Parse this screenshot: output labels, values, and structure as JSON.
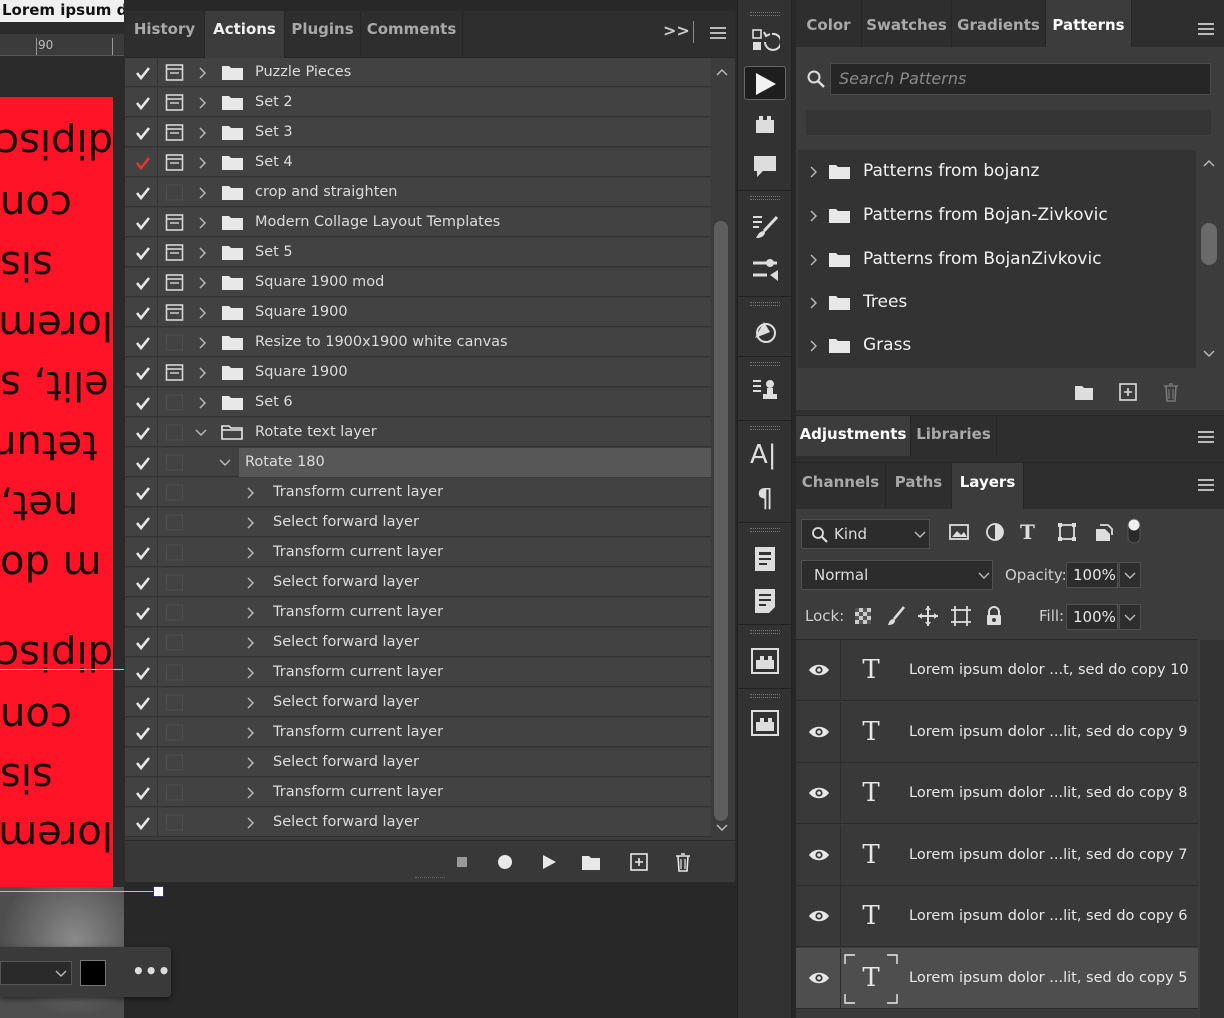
{
  "document": {
    "title": "Lorem ipsum do",
    "ruler_value": "90",
    "canvas_text_lines": [
      "dipisc",
      "con",
      "sis",
      "lorem",
      "elit, s",
      "tetur",
      "net,",
      "m do",
      "dipisc",
      "con",
      "sis",
      "lorem"
    ]
  },
  "actions_panel": {
    "tabs": [
      {
        "label": "History",
        "active": false
      },
      {
        "label": "Actions",
        "active": true
      },
      {
        "label": "Plugins",
        "active": false
      },
      {
        "label": "Comments",
        "active": false
      }
    ],
    "collapse_glyph": ">>",
    "rows": [
      {
        "label": "Puzzle Pieces",
        "level": 0,
        "check_color": "white",
        "dialog": true,
        "expanded": false
      },
      {
        "label": "Set 2",
        "level": 0,
        "check_color": "white",
        "dialog": true,
        "expanded": false
      },
      {
        "label": "Set 3",
        "level": 0,
        "check_color": "white",
        "dialog": true,
        "expanded": false
      },
      {
        "label": "Set 4",
        "level": 0,
        "check_color": "red",
        "dialog": true,
        "expanded": false
      },
      {
        "label": "crop and straighten",
        "level": 0,
        "check_color": "white",
        "dialog": false,
        "expanded": false
      },
      {
        "label": "Modern Collage Layout Templates",
        "level": 0,
        "check_color": "white",
        "dialog": true,
        "expanded": false
      },
      {
        "label": "Set 5",
        "level": 0,
        "check_color": "white",
        "dialog": true,
        "expanded": false
      },
      {
        "label": "Square 1900 mod",
        "level": 0,
        "check_color": "white",
        "dialog": true,
        "expanded": false
      },
      {
        "label": "Square 1900",
        "level": 0,
        "check_color": "white",
        "dialog": true,
        "expanded": false
      },
      {
        "label": "Resize to 1900x1900 white canvas",
        "level": 0,
        "check_color": "white",
        "dialog": false,
        "expanded": false
      },
      {
        "label": "Square 1900",
        "level": 0,
        "check_color": "white",
        "dialog": true,
        "expanded": false
      },
      {
        "label": "Set 6",
        "level": 0,
        "check_color": "white",
        "dialog": false,
        "expanded": false
      },
      {
        "label": "Rotate text layer",
        "level": 0,
        "check_color": "white",
        "dialog": false,
        "expanded": true
      },
      {
        "label": "Rotate 180",
        "level": 1,
        "check_color": "white",
        "dialog": false,
        "expanded": true,
        "selected": true
      },
      {
        "label": "Transform current layer",
        "level": 2,
        "check_color": "white",
        "dialog": false
      },
      {
        "label": "Select forward layer",
        "level": 2,
        "check_color": "white",
        "dialog": false
      },
      {
        "label": "Transform current layer",
        "level": 2,
        "check_color": "white",
        "dialog": false
      },
      {
        "label": "Select forward layer",
        "level": 2,
        "check_color": "white",
        "dialog": false
      },
      {
        "label": "Transform current layer",
        "level": 2,
        "check_color": "white",
        "dialog": false
      },
      {
        "label": "Select forward layer",
        "level": 2,
        "check_color": "white",
        "dialog": false
      },
      {
        "label": "Transform current layer",
        "level": 2,
        "check_color": "white",
        "dialog": false
      },
      {
        "label": "Select forward layer",
        "level": 2,
        "check_color": "white",
        "dialog": false
      },
      {
        "label": "Transform current layer",
        "level": 2,
        "check_color": "white",
        "dialog": false
      },
      {
        "label": "Select forward layer",
        "level": 2,
        "check_color": "white",
        "dialog": false
      },
      {
        "label": "Transform current layer",
        "level": 2,
        "check_color": "white",
        "dialog": false
      },
      {
        "label": "Select forward layer",
        "level": 2,
        "check_color": "white",
        "dialog": false
      }
    ],
    "footer_icons": [
      "stop-icon",
      "record-icon",
      "play-icon",
      "new-set-icon",
      "new-action-icon",
      "delete-icon"
    ]
  },
  "patterns_panel": {
    "tabs": [
      {
        "label": "Color",
        "active": false
      },
      {
        "label": "Swatches",
        "active": false
      },
      {
        "label": "Gradients",
        "active": false
      },
      {
        "label": "Patterns",
        "active": true
      }
    ],
    "search_placeholder": "Search Patterns",
    "groups": [
      "Patterns from bojanz",
      "Patterns from Bojan-Zivkovic",
      "Patterns from BojanZivkovic",
      "Trees",
      "Grass"
    ]
  },
  "adjustments_panel": {
    "tabs": [
      {
        "label": "Adjustments",
        "active": true
      },
      {
        "label": "Libraries",
        "active": false
      }
    ]
  },
  "layers_panel": {
    "tabs": [
      {
        "label": "Channels",
        "active": false
      },
      {
        "label": "Paths",
        "active": false
      },
      {
        "label": "Layers",
        "active": true
      }
    ],
    "filter_kind": "Kind",
    "blend_mode": "Normal",
    "opacity_label": "Opacity:",
    "opacity_value": "100%",
    "lock_label": "Lock:",
    "fill_label": "Fill:",
    "fill_value": "100%",
    "thumb_glyph": "T",
    "layers": [
      {
        "name": "Lorem ipsum dolor ...t, sed do copy 10",
        "selected": false
      },
      {
        "name": "Lorem ipsum dolor ...lit, sed do copy 9",
        "selected": false
      },
      {
        "name": "Lorem ipsum dolor ...lit, sed do copy 8",
        "selected": false
      },
      {
        "name": "Lorem ipsum dolor ...lit, sed do copy 7",
        "selected": false
      },
      {
        "name": "Lorem ipsum dolor ...lit, sed do copy 6",
        "selected": false
      },
      {
        "name": "Lorem ipsum dolor ...lit, sed do copy 5",
        "selected": true
      }
    ]
  },
  "colors": {
    "canvas_red": "#ff1427",
    "check_red": "#e03a2f",
    "panel_bg": "#3c3c3c",
    "tab_bg": "#2e2e2e"
  }
}
